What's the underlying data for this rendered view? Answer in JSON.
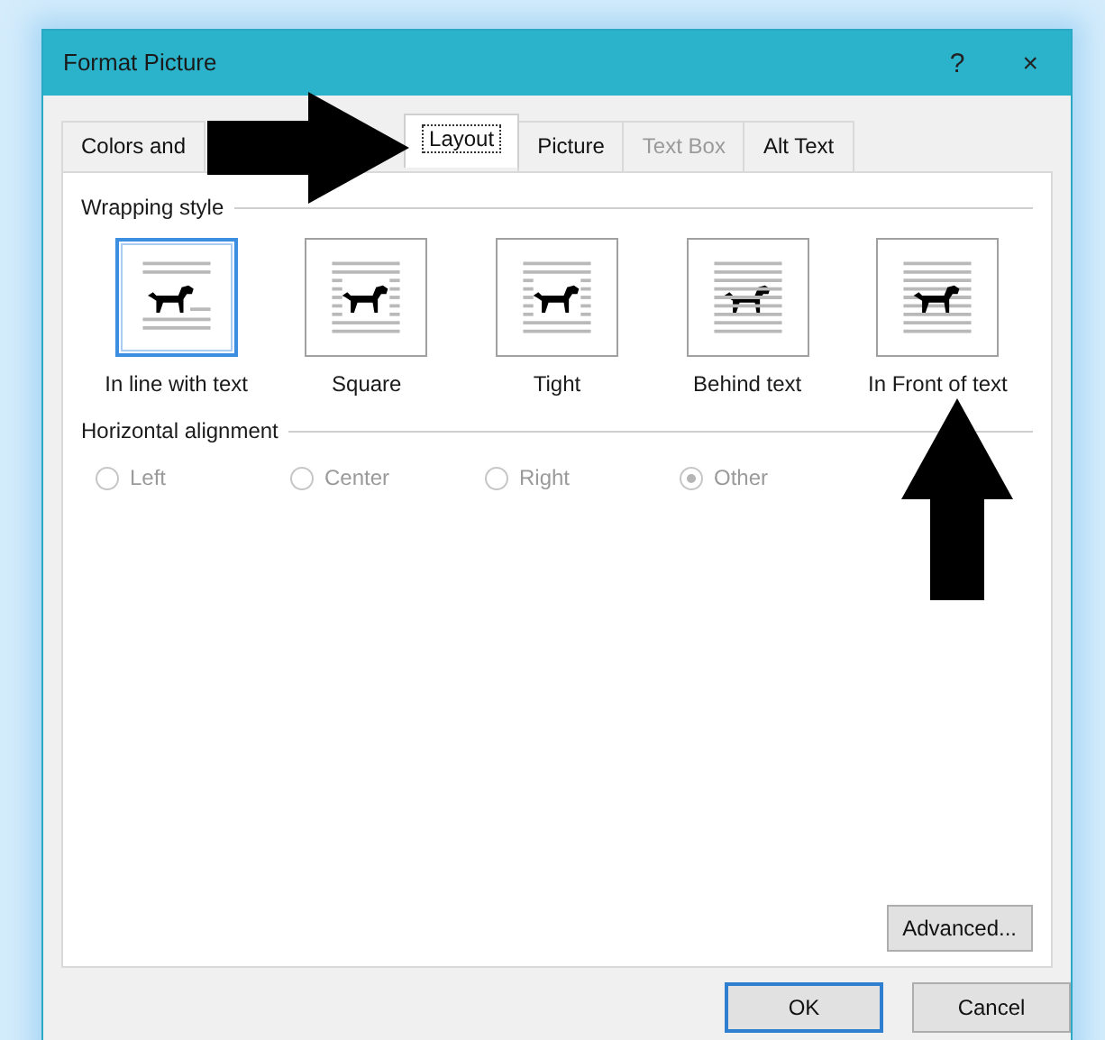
{
  "window": {
    "title": "Format Picture",
    "help_button": "?",
    "close_button": "×"
  },
  "tabs": [
    {
      "label": "Colors and",
      "selected": false,
      "disabled": false
    },
    {
      "label": "Layout",
      "selected": true,
      "disabled": false
    },
    {
      "label": "Picture",
      "selected": false,
      "disabled": false
    },
    {
      "label": "Text Box",
      "selected": false,
      "disabled": true
    },
    {
      "label": "Alt Text",
      "selected": false,
      "disabled": false
    }
  ],
  "wrapping_style": {
    "heading": "Wrapping style",
    "options": [
      {
        "kind": "inline",
        "label": "In line with text",
        "selected": true
      },
      {
        "kind": "square",
        "label": "Square",
        "selected": false
      },
      {
        "kind": "tight",
        "label": "Tight",
        "selected": false
      },
      {
        "kind": "behind",
        "label": "Behind text",
        "selected": false
      },
      {
        "kind": "front",
        "label": "In Front of text",
        "selected": false
      }
    ]
  },
  "horizontal_alignment": {
    "heading": "Horizontal alignment",
    "disabled": true,
    "options": [
      {
        "label": "Left",
        "selected": false
      },
      {
        "label": "Center",
        "selected": false
      },
      {
        "label": "Right",
        "selected": false
      },
      {
        "label": "Other",
        "selected": true
      }
    ]
  },
  "advanced_button": "Advanced...",
  "buttons": [
    {
      "label": "OK",
      "default": true
    },
    {
      "label": "Cancel",
      "default": false
    }
  ],
  "annotations": [
    {
      "kind": "arrow-right"
    },
    {
      "kind": "arrow-up"
    }
  ]
}
